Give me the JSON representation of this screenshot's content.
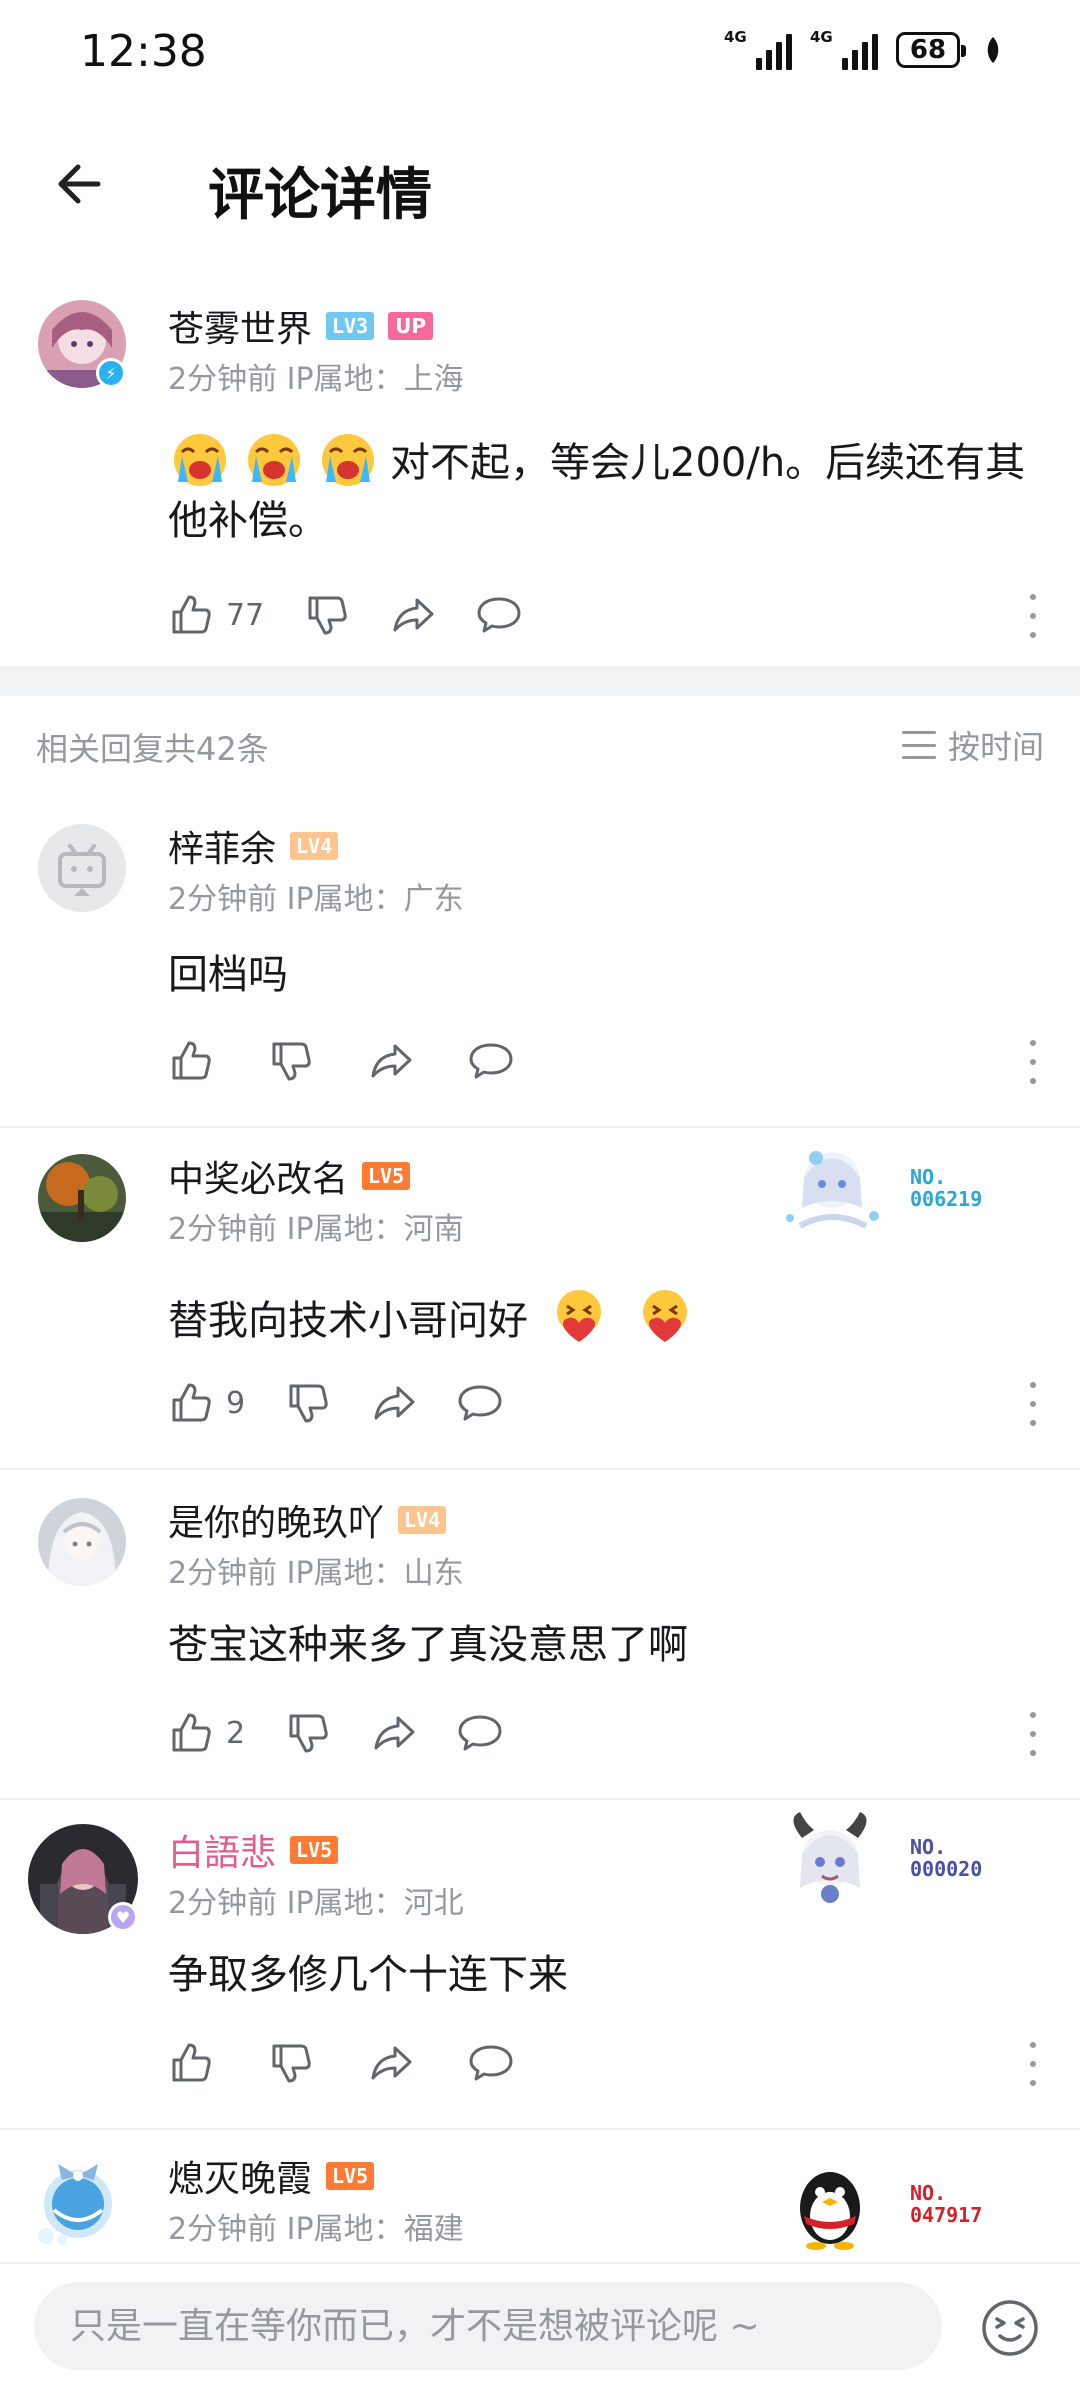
{
  "status_bar": {
    "time": "12:38",
    "battery": "68",
    "network_1": "4G",
    "network_2": "4G"
  },
  "header": {
    "title": "评论详情"
  },
  "main_comment": {
    "username": "苍雾世界",
    "level": "LV3",
    "up_tag": "UP",
    "time": "2分钟前",
    "ip": "IP属地：上海",
    "text": "对不起，等会儿200/h。后续还有其他补偿。",
    "likes": "77"
  },
  "replies_header": {
    "count_label": "相关回复共42条",
    "sort_label": "按时间"
  },
  "replies": [
    {
      "username": "梓菲余",
      "level": "LV4",
      "time": "2分钟前",
      "ip": "IP属地：广东",
      "text": "回档吗",
      "likes": ""
    },
    {
      "username": "中奖必改名",
      "level": "LV5",
      "time": "2分钟前",
      "ip": "IP属地：河南",
      "text": "替我向技术小哥问好",
      "likes": "9",
      "fan_badge": {
        "line1": "NO.",
        "line2": "006219",
        "color": "#2aa7d9"
      }
    },
    {
      "username": "是你的晚玖吖",
      "level": "LV4",
      "time": "2分钟前",
      "ip": "IP属地：山东",
      "text": "苍宝这种来多了真没意思了啊",
      "likes": "2"
    },
    {
      "username": "白語悲",
      "level": "LV5",
      "time": "2分钟前",
      "ip": "IP属地：河北",
      "text": "争取多修几个十连下来",
      "likes": "",
      "fan_badge": {
        "line1": "NO.",
        "line2": "000020",
        "color": "#4a4fa8"
      }
    },
    {
      "username": "熄灭晚霞",
      "level": "LV5",
      "time": "2分钟前",
      "ip": "IP属地：福建",
      "text": "",
      "likes": "",
      "fan_badge": {
        "line1": "NO.",
        "line2": "047917",
        "color": "#d6202a"
      }
    }
  ],
  "reply_input": {
    "placeholder": "只是一直在等你而已，才不是想被评论呢 ~"
  },
  "colors": {
    "accent_pink": "#f66a9b",
    "lv3": "#6ec8f0",
    "lv4": "#ffc58e",
    "lv5": "#ff7a33",
    "muted": "#9499a0"
  },
  "icons": [
    "back-arrow-icon",
    "like-icon",
    "dislike-icon",
    "share-icon",
    "comment-icon",
    "more-icon",
    "sort-icon",
    "emoji-icon"
  ]
}
